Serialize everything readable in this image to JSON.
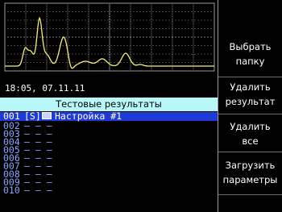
{
  "status": {
    "timestamp": "18:05, 07.11.11"
  },
  "results": {
    "header": "Тестовые результаты",
    "rows": [
      {
        "idx": "001",
        "flag": "[S]",
        "name": "Настройка #1",
        "has_icon": true,
        "selected": true
      },
      {
        "idx": "002",
        "flag": "",
        "name": "– – –",
        "has_icon": false,
        "selected": false
      },
      {
        "idx": "003",
        "flag": "",
        "name": "– – –",
        "has_icon": false,
        "selected": false
      },
      {
        "idx": "004",
        "flag": "",
        "name": "– – –",
        "has_icon": false,
        "selected": false
      },
      {
        "idx": "005",
        "flag": "",
        "name": "– – –",
        "has_icon": false,
        "selected": false
      },
      {
        "idx": "006",
        "flag": "",
        "name": "– – –",
        "has_icon": false,
        "selected": false
      },
      {
        "idx": "007",
        "flag": "",
        "name": "– – –",
        "has_icon": false,
        "selected": false
      },
      {
        "idx": "008",
        "flag": "",
        "name": "– – –",
        "has_icon": false,
        "selected": false
      },
      {
        "idx": "009",
        "flag": "",
        "name": "– – –",
        "has_icon": false,
        "selected": false
      },
      {
        "idx": "010",
        "flag": "",
        "name": "– – –",
        "has_icon": false,
        "selected": false
      }
    ]
  },
  "sidebar": {
    "buttons": [
      {
        "line1": "Выбрать",
        "line2": "папку"
      },
      {
        "line1": "Удалить",
        "line2": "результат"
      },
      {
        "line1": "Удалить",
        "line2": "все"
      },
      {
        "line1": "Загрузить",
        "line2": "параметры"
      }
    ]
  },
  "colors": {
    "trace": "#f4f07a",
    "grid": "#cfcfcf",
    "header_bg": "#b8f8f8",
    "selected_bg": "#1e3bd6",
    "row_text": "#8fa6ff"
  }
}
